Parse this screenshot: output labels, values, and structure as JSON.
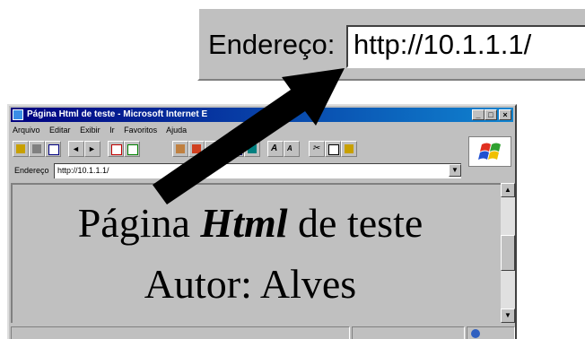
{
  "zoom": {
    "label": "Endereço:",
    "url": "http://10.1.1.1/"
  },
  "window": {
    "title": "Página Html de teste - Microsoft Internet E",
    "menu": [
      "Arquivo",
      "Editar",
      "Exibir",
      "Ir",
      "Favoritos",
      "Ajuda"
    ],
    "address_label": "Endereço",
    "address_value": "http://10.1.1.1/",
    "controls": {
      "minimize": "_",
      "maximize": "□",
      "close": "×"
    }
  },
  "content": {
    "title_before": "Página ",
    "title_emph": "Html",
    "title_after": " de teste",
    "author": "Autor: Alves"
  },
  "colors": {
    "chrome": "#c0c0c0",
    "titlebar": "#000080",
    "arrow": "#000000"
  },
  "icons": [
    "edit-icon",
    "print-icon",
    "mail-icon",
    "back-icon",
    "forward-icon",
    "stop-icon",
    "refresh-icon",
    "home-icon",
    "search-icon",
    "favorites-icon",
    "history-icon",
    "channels-icon",
    "fullscreen-icon",
    "font-larger-icon",
    "font-smaller-icon",
    "cut-icon",
    "copy-icon",
    "paste-icon",
    "windows-logo-icon"
  ]
}
